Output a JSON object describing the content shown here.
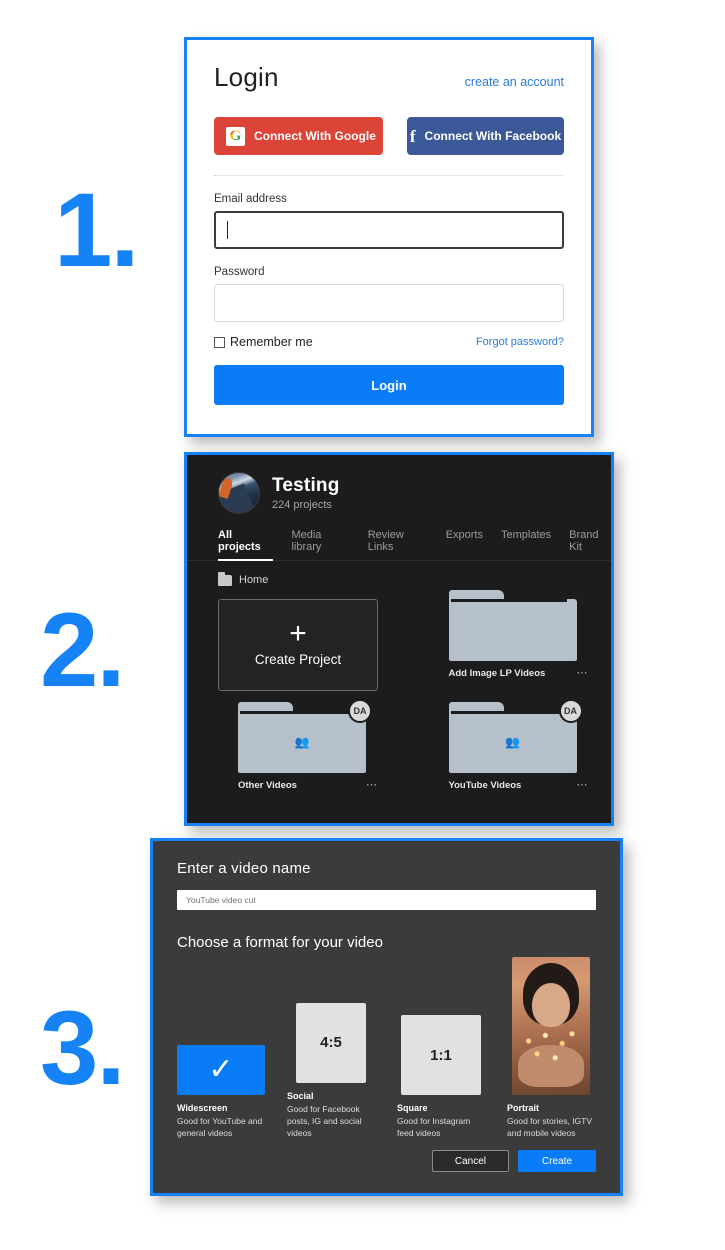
{
  "steps": {
    "one": "1.",
    "two": "2.",
    "three": "3."
  },
  "login": {
    "title": "Login",
    "create_account_link": "create an account",
    "google_button": "Connect With Google",
    "google_icon": "google-g-icon",
    "google_color": "#db4437",
    "facebook_button": "Connect With Facebook",
    "facebook_icon": "facebook-f-icon",
    "facebook_color": "#3b5998",
    "email_label": "Email address",
    "email_value": "",
    "email_placeholder": "",
    "password_label": "Password",
    "password_value": "",
    "password_placeholder": "",
    "remember_label": "Remember me",
    "forgot_link": "Forgot password?",
    "submit_label": "Login",
    "accent_color": "#0a7cf7"
  },
  "projects": {
    "workspace_name": "Testing",
    "project_count": "224 projects",
    "avatar_icon": "mountain-avatar",
    "tabs": [
      {
        "label": "All projects",
        "active": true
      },
      {
        "label": "Media library",
        "active": false
      },
      {
        "label": "Review Links",
        "active": false
      },
      {
        "label": "Exports",
        "active": false
      },
      {
        "label": "Templates",
        "active": false
      },
      {
        "label": "Brand Kit",
        "active": false
      }
    ],
    "breadcrumb": "Home",
    "breadcrumb_icon": "folder-icon",
    "create_card": {
      "label": "Create Project",
      "icon": "plus-icon"
    },
    "folders": [
      {
        "name": "Add Image LP Videos",
        "badge": "",
        "shared": false,
        "menu": "⋯"
      },
      {
        "name": "Other Videos",
        "badge": "DA",
        "shared": true,
        "menu": "⋯"
      },
      {
        "name": "YouTube Videos",
        "badge": "DA",
        "shared": true,
        "menu": "⋯"
      }
    ]
  },
  "create_video": {
    "name_heading": "Enter a video name",
    "name_value": "YouTube video cut",
    "name_placeholder": "YouTube video cut",
    "format_heading": "Choose a format for your video",
    "formats": [
      {
        "title": "Widescreen",
        "desc": "Good for YouTube and general videos",
        "ratio": "",
        "selected": true,
        "icon": "check-icon"
      },
      {
        "title": "Social",
        "desc": "Good for Facebook posts, IG and social videos",
        "ratio": "4:5",
        "selected": false,
        "icon": ""
      },
      {
        "title": "Square",
        "desc": "Good for Instagram feed videos",
        "ratio": "1:1",
        "selected": false,
        "icon": ""
      },
      {
        "title": "Portrait",
        "desc": "Good for stories, IGTV and mobile videos",
        "ratio": "",
        "selected": false,
        "icon": "portrait-thumbnail"
      }
    ],
    "cancel_label": "Cancel",
    "create_label": "Create",
    "accent_color": "#0a7cf7"
  }
}
